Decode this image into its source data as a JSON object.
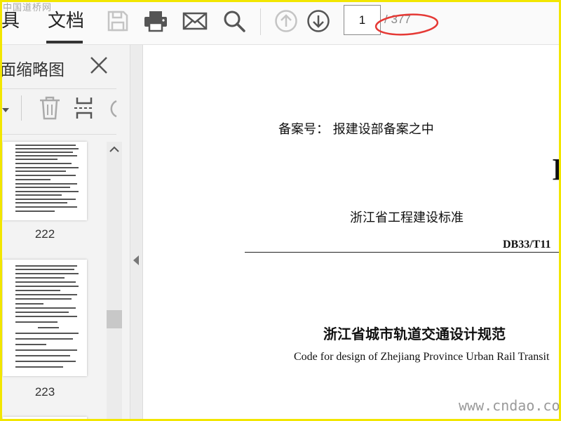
{
  "watermark_top": "中国道桥网",
  "watermark_bottom": "www.cndao.com",
  "toolbar": {
    "tab_tools": "具",
    "tab_document": "文档",
    "icons": [
      "save-icon",
      "print-icon",
      "mail-icon",
      "search-icon",
      "arrow-up-icon",
      "arrow-down-icon"
    ],
    "page_current": "1",
    "page_total": "/ 377",
    "annotation_color": "#e53935"
  },
  "sidebar": {
    "title": "面缩略图",
    "tools": [
      "chevron-down-icon",
      "trash-icon",
      "insert-page-icon",
      "rotate-icon"
    ],
    "thumbnails": [
      {
        "label": "222"
      },
      {
        "label": "223"
      }
    ]
  },
  "document": {
    "record_label": "备案号：  报建设部备案之中",
    "standard_org": "浙江省工程建设标准",
    "standard_code": "DB33/T11",
    "title_cn": "浙江省城市轨道交通设计规范",
    "title_en": "Code for design of Zhejiang Province Urban Rail Transit",
    "cut_letter": "I"
  },
  "colors": {
    "frame": "#f2e600",
    "toolbar_bg": "#fafafa",
    "sidebar_bg": "#f3f3f3"
  }
}
